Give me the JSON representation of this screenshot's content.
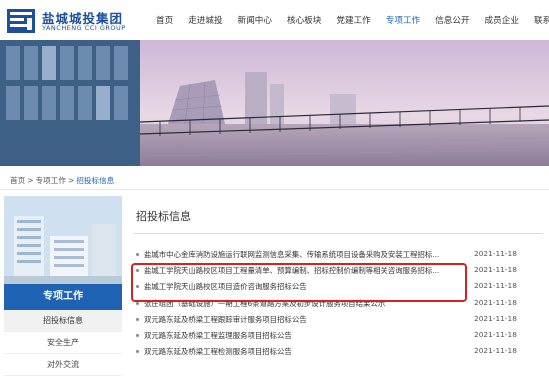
{
  "brand": {
    "cn_name": "盐城城投集团",
    "en_name": "YANCHENG CCI GROUP",
    "color": "#1c4f9c"
  },
  "nav": {
    "items": [
      "首页",
      "走进城投",
      "新闻中心",
      "核心板块",
      "党建工作",
      "专项工作",
      "信息公开",
      "成员企业",
      "联系我们"
    ],
    "active": "专项工作",
    "active_color": "#1c63b8"
  },
  "breadcrumb": {
    "home": "首页",
    "sep": ">",
    "section": "专项工作",
    "current": "招投标信息"
  },
  "sidebar": {
    "title": "专项工作",
    "title_bg": "#1f63b4",
    "items": [
      "招投标信息",
      "安全生产",
      "对外交流"
    ],
    "active": "招投标信息"
  },
  "main": {
    "title": "招投标信息",
    "rows": [
      {
        "title": "盐城市中心金库消防设施运行联网监测信息采集、传输系统项目设备采购及安装工程招标...",
        "date": "2021-11-18"
      },
      {
        "title": "盐城工学院天山路校区项目工程量清单、预算编制、招标控制价编制等相关咨询服务招标...",
        "date": "2021-11-18"
      },
      {
        "title": "盐城工学院天山路校区项目造价咨询服务招标公告",
        "date": "2021-11-18"
      },
      {
        "title": "张庄组团（基础设施）一期工程6条道路方案及初步设计服务项目结果公示",
        "date": "2021-11-18"
      },
      {
        "title": "双元路东延及桥梁工程跟踪审计服务项目招标公告",
        "date": "2021-11-18"
      },
      {
        "title": "双元路东延及桥梁工程监理服务项目招标公告",
        "date": "2021-11-18"
      },
      {
        "title": "双元路东延及桥梁工程检测服务项目招标公告",
        "date": "2021-11-18"
      }
    ],
    "highlight_color": "#d62222"
  }
}
